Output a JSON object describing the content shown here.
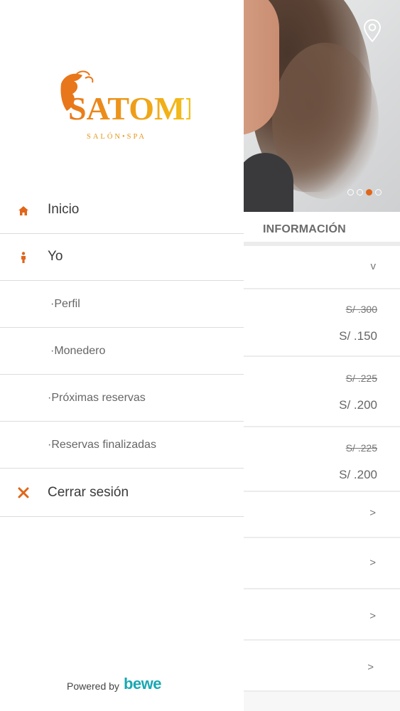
{
  "background": {
    "hero": {
      "carousel_dots": 4,
      "active_dot": 2,
      "location_icon": "map-pin-icon"
    },
    "section_title": "INFORMACIÓN",
    "dropdown_chevron": "v",
    "price_rows": [
      {
        "old": "S/ .300",
        "new": "S/ .150"
      },
      {
        "old": "S/ .225",
        "new": "S/ .200"
      },
      {
        "old": "S/ .225",
        "new": "S/ .200"
      }
    ],
    "nav_chevron": ">"
  },
  "drawer": {
    "logo": {
      "brand": "SATOMI",
      "tagline": "SALÓN•SPA"
    },
    "menu": [
      {
        "label": "Inicio",
        "icon": "home-icon"
      },
      {
        "label": "Yo",
        "icon": "person-icon"
      },
      {
        "label": "·Perfil"
      },
      {
        "label": "·Monedero"
      },
      {
        "label": "·Próximas reservas"
      },
      {
        "label": "·Reservas finalizadas"
      },
      {
        "label": "Cerrar sesión",
        "icon": "close-icon"
      }
    ],
    "footer": {
      "powered_by": "Powered by",
      "brand": "bewe"
    }
  },
  "colors": {
    "accent": "#e0661a",
    "brand_teal": "#19a8b2",
    "logo_gold": "#f0a51c"
  }
}
